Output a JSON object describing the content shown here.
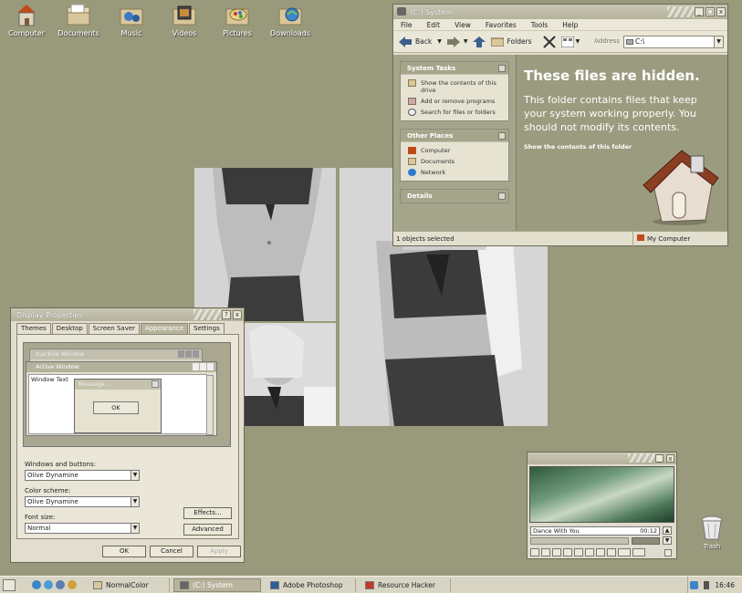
{
  "desktop": {
    "icons": [
      {
        "label": "Computer"
      },
      {
        "label": "Documents"
      },
      {
        "label": "Music"
      },
      {
        "label": "Videos"
      },
      {
        "label": "Pictures"
      },
      {
        "label": "Downloads"
      }
    ],
    "trash_label": "Trash"
  },
  "explorer": {
    "title": "(C:) System",
    "menu": [
      "File",
      "Edit",
      "View",
      "Favorites",
      "Tools",
      "Help"
    ],
    "back_label": "Back",
    "folders_label": "Folders",
    "address_label": "Address",
    "address_value": "C:\\",
    "system_tasks": {
      "header": "System Tasks",
      "items": [
        "Show the contents of this drive",
        "Add or remove programs",
        "Search for files or folders"
      ]
    },
    "other_places": {
      "header": "Other Places",
      "items": [
        "Computer",
        "Documents",
        "Network"
      ]
    },
    "details_header": "Details",
    "hidden_heading": "These files are hidden.",
    "hidden_text": "This folder contains files that keep your system working properly. You should not modify its contents.",
    "hidden_link": "Show the contents of this folder",
    "status_left": "1 objects selected",
    "status_right": "My Computer"
  },
  "display_properties": {
    "title": "Display Properties",
    "tabs": [
      "Themes",
      "Desktop",
      "Screen Saver",
      "Appearance",
      "Settings"
    ],
    "selected_tab": "Appearance",
    "preview": {
      "inactive_title": "Inactive Window",
      "active_title": "Active Window",
      "window_text": "Window Text",
      "message_title": "Message...",
      "ok_label": "OK"
    },
    "windows_buttons_label": "Windows and buttons:",
    "windows_buttons_value": "Olive Dynamine",
    "color_scheme_label": "Color scheme:",
    "color_scheme_value": "Olive Dynamine",
    "font_size_label": "Font size:",
    "font_size_value": "Normal",
    "effects_label": "Effects...",
    "advanced_label": "Advanced",
    "ok_label": "OK",
    "cancel_label": "Cancel",
    "apply_label": "Apply"
  },
  "media_player": {
    "track": "Dance With You",
    "time": "00:12"
  },
  "taskbar": {
    "items": [
      {
        "label": "NormalColor",
        "active": false
      },
      {
        "label": "(C:) System",
        "active": true
      },
      {
        "label": "Adobe Photoshop",
        "active": false
      },
      {
        "label": "Resource Hacker",
        "active": false
      }
    ],
    "clock": "16:46"
  },
  "colors": {
    "desktop": "#999a7c",
    "title_bar": "#b5b29c",
    "task_pane": "#a5a58b"
  }
}
